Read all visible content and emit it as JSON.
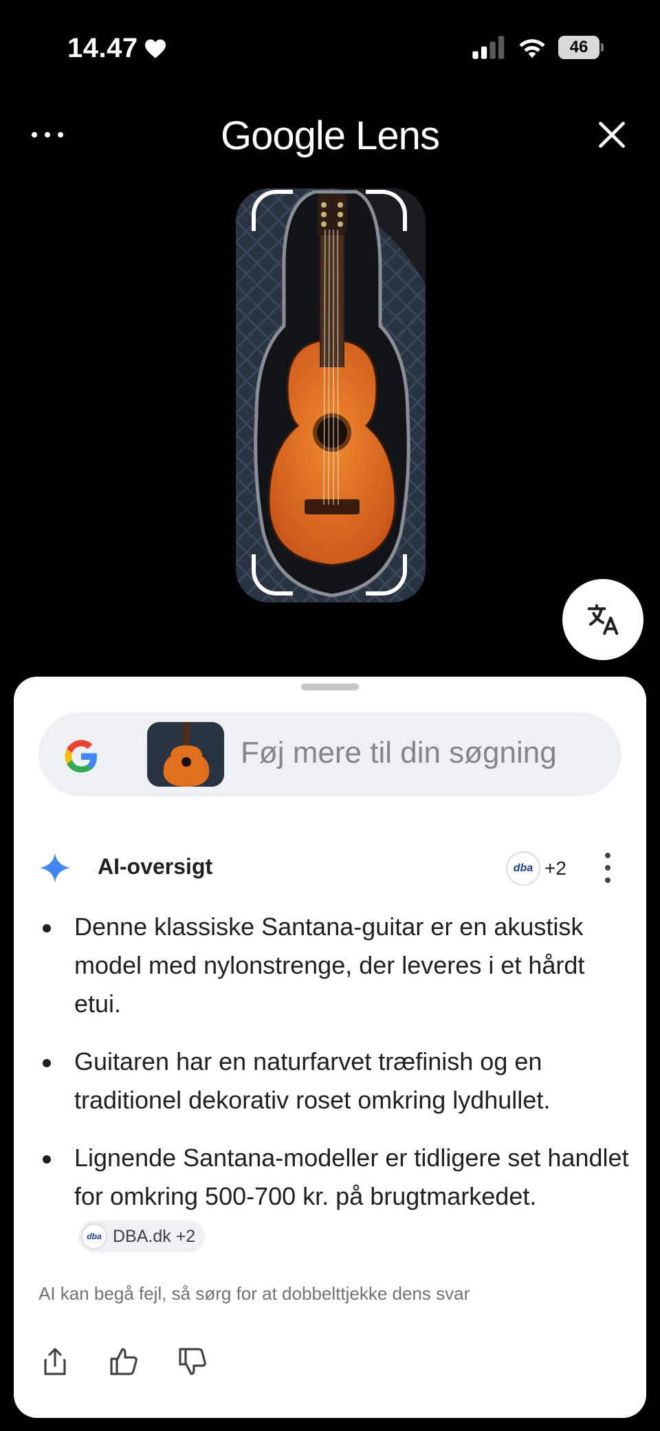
{
  "status_bar": {
    "time": "14.47",
    "battery_level": "46",
    "icons": [
      "heart-icon",
      "signal-icon",
      "wifi-icon",
      "battery-icon"
    ]
  },
  "header": {
    "title": "Google Lens",
    "left_icon": "more-icon",
    "right_icon": "close-icon"
  },
  "preview": {
    "subject_icon": "guitar-in-case-photo"
  },
  "translate_button": {
    "icon": "translate-icon"
  },
  "search": {
    "placeholder": "Føj mere til din søgning",
    "brand_icon": "google-g-icon"
  },
  "ai_overview": {
    "title": "AI-oversigt",
    "source_logo": "dba",
    "source_count": "+2",
    "bullets": [
      "Denne klassiske Santana-guitar er en akustisk model med nylonstrenge, der leveres i et hårdt etui.",
      "Guitaren har en naturfarvet træfinish og en traditionel dekorativ roset omkring lydhullet.",
      "Lignende Santana-modeller er tidligere set handlet for omkring 500-700 kr. på brugtmarkedet."
    ],
    "bullet3_chip": "DBA.dk +2",
    "disclaimer": "AI kan begå fejl, så sørg for at dobbelttjekke dens svar"
  },
  "actions": [
    "share-icon",
    "thumbs-up-icon",
    "thumbs-down-icon"
  ],
  "colors": {
    "background": "#000000",
    "sheet": "#ffffff",
    "search_bar": "#eef1f3",
    "guitar_body": "#e0701e",
    "sparkle": "#4285f4"
  }
}
